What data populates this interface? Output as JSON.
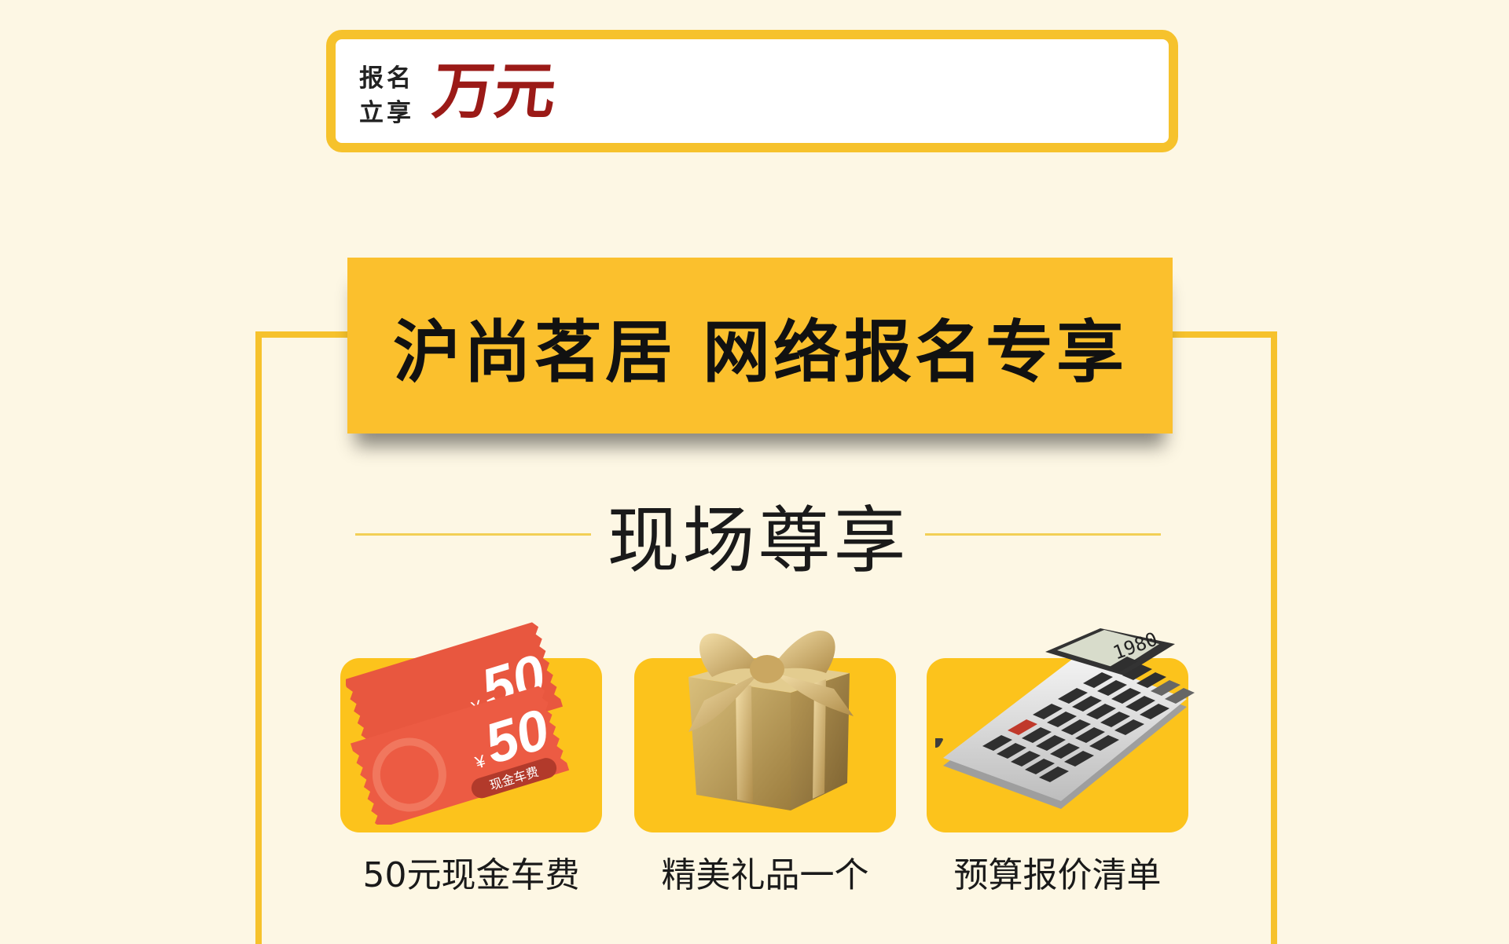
{
  "signup": {
    "line1": "报名",
    "line2": "立享",
    "amount": "万元"
  },
  "banner": {
    "title": "沪尚茗居 网络报名专享"
  },
  "section": {
    "title": "现场尊享"
  },
  "benefits": [
    {
      "label": "50元现金车费",
      "icon": "cash-voucher-icon",
      "ticket_value": "50",
      "ticket_currency": "¥",
      "ticket_caption": "现金车费"
    },
    {
      "label": "精美礼品一个",
      "icon": "gift-box-icon"
    },
    {
      "label": "预算报价清单",
      "icon": "calculator-icon",
      "display": "1980"
    }
  ],
  "colors": {
    "background": "#fdf7e4",
    "accent_yellow": "#fbc02d",
    "amount_red": "#9b1a17",
    "ticket_red": "#e8573f"
  }
}
